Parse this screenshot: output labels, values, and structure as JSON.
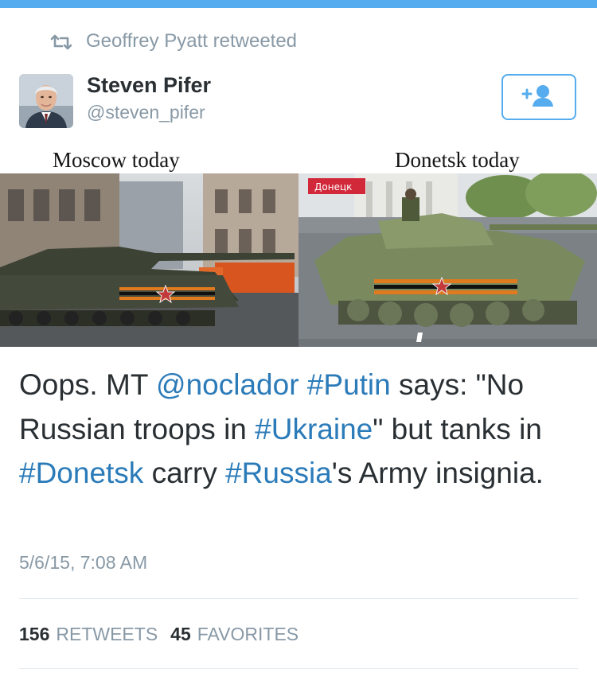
{
  "retweet_context": {
    "icon": "retweet-icon",
    "text": "Geoffrey Pyatt retweeted"
  },
  "author": {
    "name": "Steven Pifer",
    "handle": "@steven_pifer",
    "avatar_icon": "avatar"
  },
  "follow_button": {
    "icon": "add-user-icon",
    "color": "#55acee"
  },
  "media": {
    "left_caption": "Moscow today",
    "right_caption": "Donetsk today",
    "right_overlay_tag": "Донецк"
  },
  "tweet": {
    "parts": {
      "p1": "Oops. MT ",
      "p2": "@noclador",
      "p3": " ",
      "p4": "#Putin",
      "p5": " says: \"No Russian troops in ",
      "p6": "#Ukraine",
      "p7": "\" but tanks in ",
      "p8": "#Donetsk",
      "p9": " carry ",
      "p10": "#Russia",
      "p11": "'s Army insignia."
    },
    "link_color": "#2b7bb9"
  },
  "timestamp": "5/6/15, 7:08 AM",
  "stats": {
    "retweets_count": "156",
    "retweets_label": "RETWEETS",
    "favorites_count": "45",
    "favorites_label": "FAVORITES"
  },
  "colors": {
    "accent": "#55acee",
    "text": "#292f33",
    "muted": "#8899a6",
    "divider": "#e1e8ed"
  }
}
